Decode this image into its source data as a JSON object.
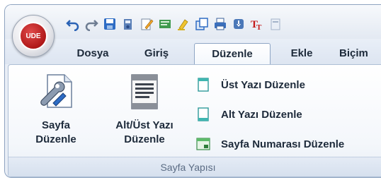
{
  "app": {
    "logo_text": "UDE"
  },
  "quick_access": {
    "icons": [
      "undo-icon",
      "redo-icon",
      "save-icon",
      "save-as-icon",
      "edit-pen-icon",
      "document-icon",
      "highlighter-icon",
      "copy-icon",
      "print-icon",
      "export-icon",
      "text-style-icon",
      "more-icon"
    ]
  },
  "tabs": [
    {
      "label": "Dosya"
    },
    {
      "label": "Giriş"
    },
    {
      "label": "Düzenle"
    },
    {
      "label": "Ekle"
    },
    {
      "label": "Biçim"
    }
  ],
  "active_tab": "Düzenle",
  "ribbon": {
    "group_label": "Sayfa Yapısı",
    "page_setup": {
      "line1": "Sayfa",
      "line2": "Düzenle"
    },
    "header_footer": {
      "line1": "Alt/Üst Yazı",
      "line2": "Düzenle"
    },
    "edit_header": "Üst Yazı Düzenle",
    "edit_footer": "Alt Yazı Düzenle",
    "edit_page_number": "Sayfa Numarası Düzenle"
  },
  "colors": {
    "accent_red": "#b01818",
    "ribbon_bg": "#f4f7fb",
    "text": "#1d2a3a",
    "group_label_text": "#5b6c84"
  }
}
